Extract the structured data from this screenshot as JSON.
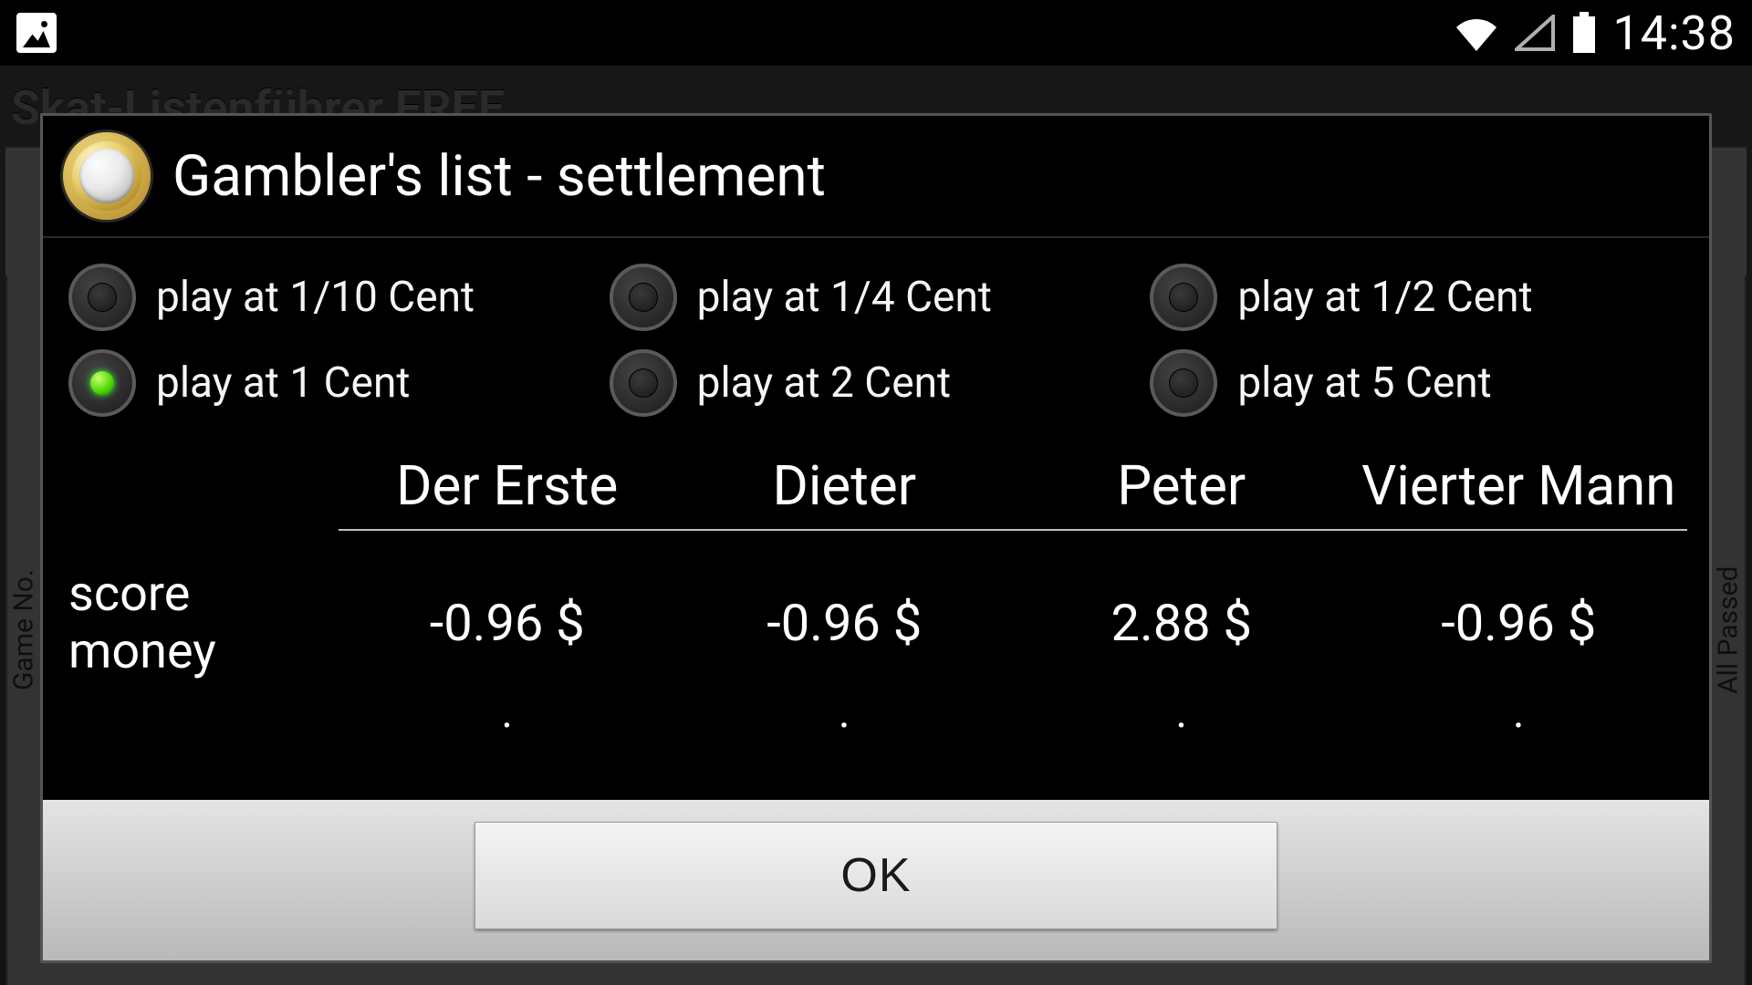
{
  "status": {
    "time": "14:38"
  },
  "background": {
    "app_title": "Skat-Listenführer FREE",
    "side_left": "Game No.",
    "side_right": "All Passed"
  },
  "dialog": {
    "title": "Gambler's list - settlement",
    "radios": [
      {
        "label": "play at 1/10 Cent",
        "checked": false
      },
      {
        "label": "play at 1/4 Cent",
        "checked": false
      },
      {
        "label": "play at 1/2 Cent",
        "checked": false
      },
      {
        "label": "play at 1 Cent",
        "checked": true
      },
      {
        "label": "play at 2 Cent",
        "checked": false
      },
      {
        "label": "play at 5 Cent",
        "checked": false
      }
    ],
    "players": [
      "Der Erste",
      "Dieter",
      "Peter",
      "Vierter Mann"
    ],
    "rows": [
      {
        "label": "score money",
        "values": [
          "-0.96 $",
          "-0.96 $",
          "2.88 $",
          "-0.96 $"
        ]
      }
    ],
    "ok_label": "OK"
  }
}
